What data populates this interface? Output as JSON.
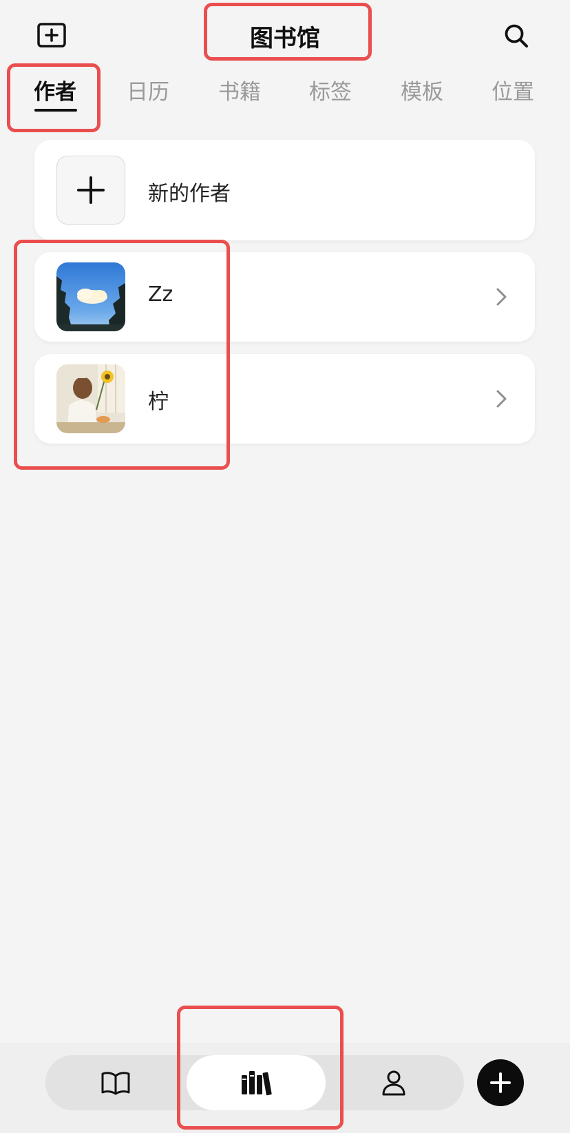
{
  "header": {
    "title": "图书馆",
    "left_icon": "add-square-icon",
    "right_icon": "search-icon"
  },
  "tabs": [
    {
      "label": "作者",
      "active": true
    },
    {
      "label": "日历",
      "active": false
    },
    {
      "label": "书籍",
      "active": false
    },
    {
      "label": "标签",
      "active": false
    },
    {
      "label": "模板",
      "active": false
    },
    {
      "label": "位置",
      "active": false
    }
  ],
  "new_author": {
    "label": "新的作者",
    "icon": "plus-icon"
  },
  "authors": [
    {
      "name": "Zz",
      "avatar": "sky-cloud-photo"
    },
    {
      "name": "柠",
      "avatar": "girl-sunflower-photo"
    }
  ],
  "bottom_nav": [
    {
      "icon": "open-book-icon",
      "active": false
    },
    {
      "icon": "library-books-icon",
      "active": true
    },
    {
      "icon": "person-icon",
      "active": false
    }
  ],
  "fab": {
    "icon": "plus-icon"
  },
  "colors": {
    "background": "#f4f4f4",
    "highlight": "#ea4e4e",
    "accent": "#111111",
    "inactive_tab": "#9a9a9a"
  }
}
